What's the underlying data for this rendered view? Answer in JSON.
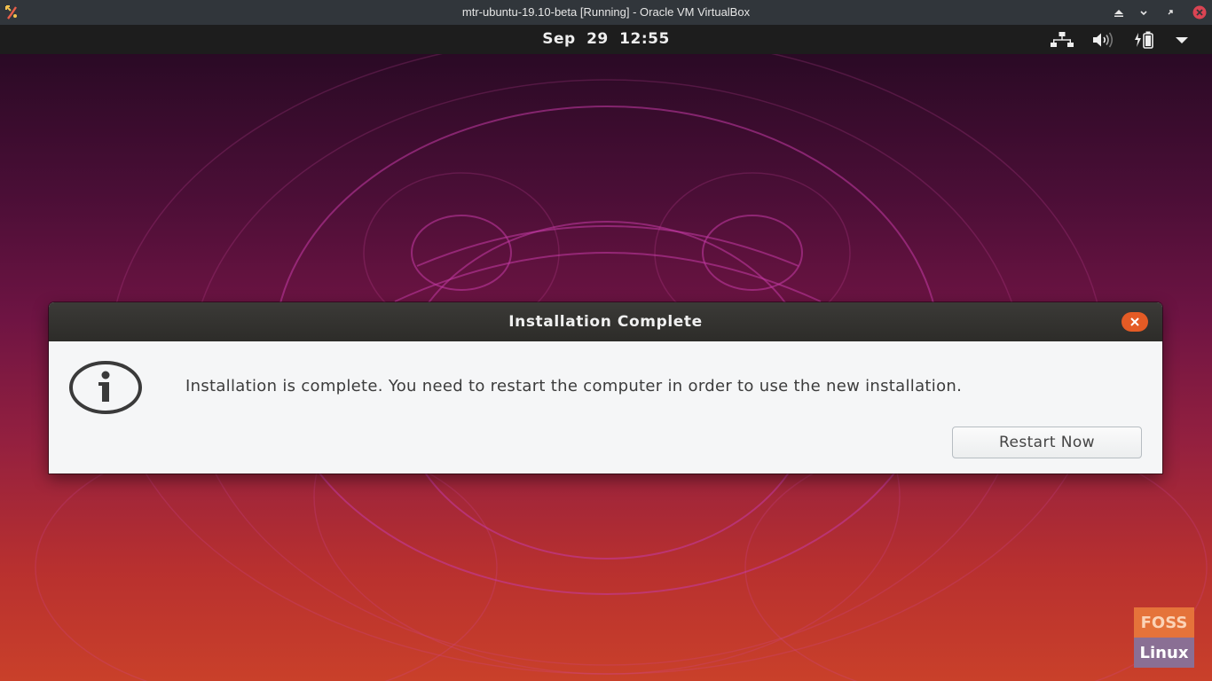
{
  "host_window": {
    "title": "mtr-ubuntu-19.10-beta [Running] - Oracle VM VirtualBox",
    "app_icon": "virtualbox-icon",
    "controls": [
      "keep-above-icon",
      "minimize-icon",
      "restore-icon",
      "close-icon"
    ],
    "close_color": "#da4453"
  },
  "top_panel": {
    "clock": "Sep 29  12:55",
    "tray_icons": [
      "network-wired-icon",
      "volume-icon",
      "battery-charging-icon",
      "system-menu-arrow-icon"
    ]
  },
  "dialog": {
    "title": "Installation Complete",
    "close_icon": "close-icon",
    "close_color": "#e45b25",
    "icon": "info-icon",
    "message": "Installation is complete. You need to restart the computer in order to use the new installation.",
    "button_label": "Restart Now"
  },
  "watermark": {
    "top_text": "FOSS",
    "bottom_text": "Linux"
  }
}
